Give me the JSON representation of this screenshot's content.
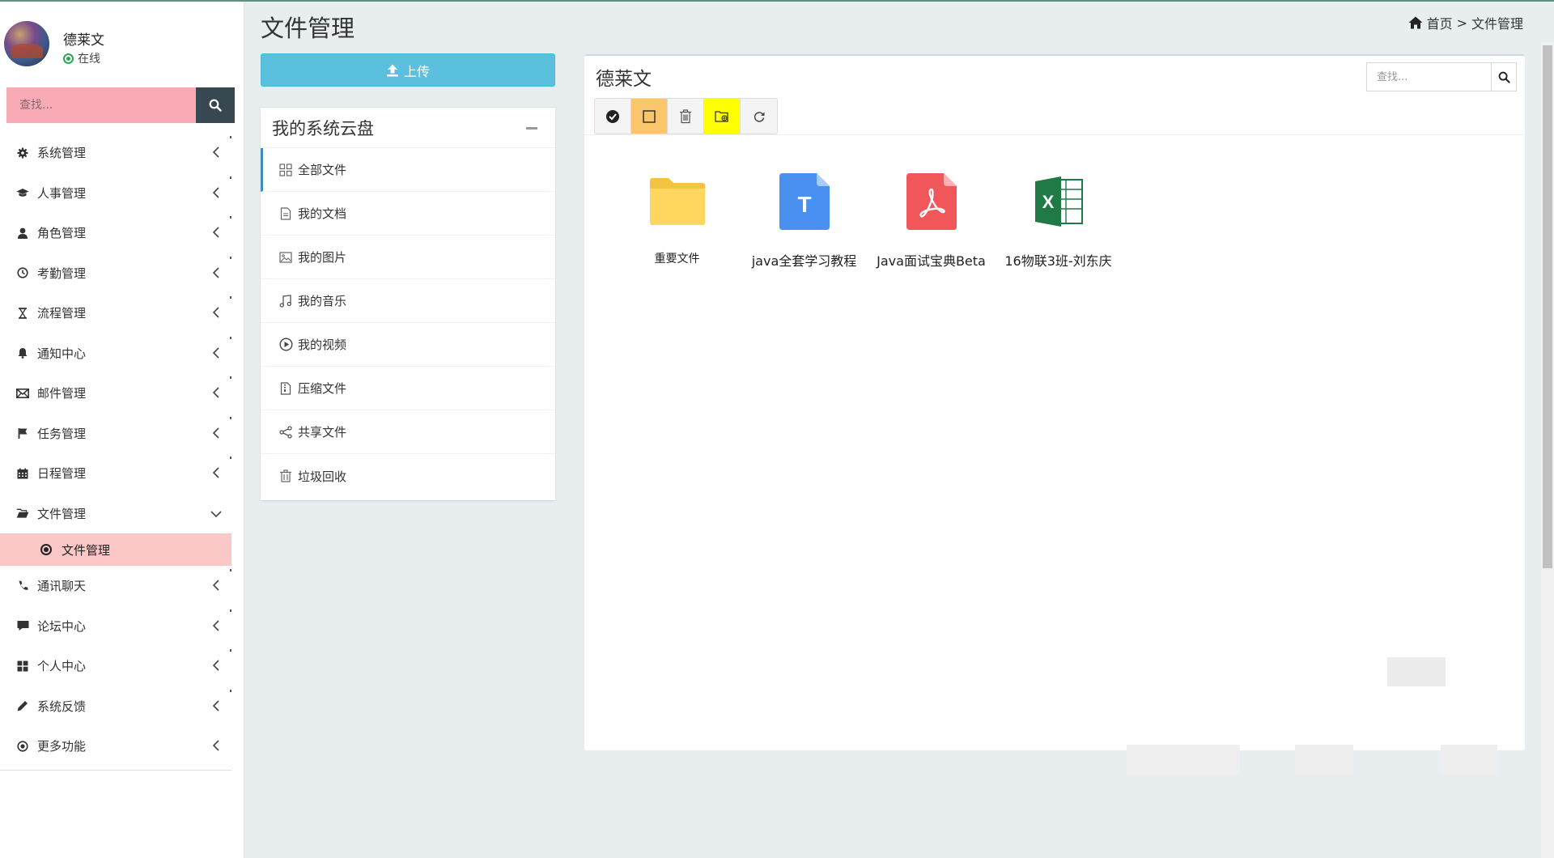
{
  "user": {
    "name": "德莱文",
    "status": "在线"
  },
  "sidebar": {
    "search_placeholder": "查找...",
    "items": [
      {
        "label": "系统管理",
        "icon": "gear-icon"
      },
      {
        "label": "人事管理",
        "icon": "graduation-cap-icon"
      },
      {
        "label": "角色管理",
        "icon": "user-icon"
      },
      {
        "label": "考勤管理",
        "icon": "clock-icon"
      },
      {
        "label": "流程管理",
        "icon": "hourglass-icon"
      },
      {
        "label": "通知中心",
        "icon": "bell-icon"
      },
      {
        "label": "邮件管理",
        "icon": "envelope-icon"
      },
      {
        "label": "任务管理",
        "icon": "flag-icon"
      },
      {
        "label": "日程管理",
        "icon": "calendar-icon"
      },
      {
        "label": "文件管理",
        "icon": "folder-open-icon"
      },
      {
        "label": "通讯聊天",
        "icon": "phone-icon"
      },
      {
        "label": "论坛中心",
        "icon": "comment-icon"
      },
      {
        "label": "个人中心",
        "icon": "grid-icon"
      },
      {
        "label": "系统反馈",
        "icon": "pencil-icon"
      },
      {
        "label": "更多功能",
        "icon": "dot-circle-icon"
      }
    ],
    "sub_item": "文件管理"
  },
  "header": {
    "title": "文件管理",
    "breadcrumb_home": "首页",
    "breadcrumb_sep": ">",
    "breadcrumb_current": "文件管理"
  },
  "upload": {
    "label": "上传"
  },
  "folders": {
    "title": "我的系统云盘",
    "items": [
      {
        "label": "全部文件",
        "icon": "grid-outline-icon"
      },
      {
        "label": "我的文档",
        "icon": "document-icon"
      },
      {
        "label": "我的图片",
        "icon": "image-icon"
      },
      {
        "label": "我的音乐",
        "icon": "music-icon"
      },
      {
        "label": "我的视频",
        "icon": "play-circle-icon"
      },
      {
        "label": "压缩文件",
        "icon": "zip-icon"
      },
      {
        "label": "共享文件",
        "icon": "share-icon"
      },
      {
        "label": "垃圾回收",
        "icon": "trash-icon"
      }
    ]
  },
  "main": {
    "title": "德莱文",
    "search_placeholder": "查找...",
    "toolbar": [
      "check-circle-icon",
      "square-icon",
      "trash-icon",
      "folder-plus-icon",
      "refresh-icon"
    ],
    "files": [
      {
        "name": "重要文件",
        "type": "folder"
      },
      {
        "name": "java全套学习教程",
        "type": "text-doc"
      },
      {
        "name": "Java面试宝典Beta",
        "type": "pdf"
      },
      {
        "name": "16物联3班-刘东庆",
        "type": "excel"
      }
    ]
  },
  "colors": {
    "accent": "#5bc0de",
    "sidebar_search_bg": "#f8aab5",
    "sidebar_active_bg": "#fcc7c7",
    "status_online": "#2aa55a",
    "active_border": "#3c8dbc"
  }
}
